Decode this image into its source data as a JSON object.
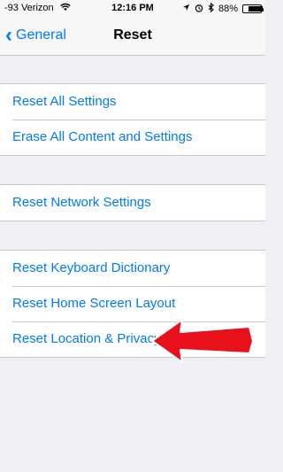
{
  "status_bar": {
    "carrier": "-93 Verizon",
    "time": "12:16 PM",
    "battery": "88%",
    "battery_level": 0.88
  },
  "nav": {
    "back_label": "General",
    "title": "Reset"
  },
  "groups": [
    {
      "rows": [
        {
          "label": "Reset All Settings"
        },
        {
          "label": "Erase All Content and Settings"
        }
      ]
    },
    {
      "rows": [
        {
          "label": "Reset Network Settings"
        }
      ]
    },
    {
      "rows": [
        {
          "label": "Reset Keyboard Dictionary"
        },
        {
          "label": "Reset Home Screen Layout"
        },
        {
          "label": "Reset Location & Privacy"
        }
      ]
    }
  ],
  "colors": {
    "accent": "#007aff",
    "annotation_arrow": "#e8101a",
    "background": "#efeff4"
  },
  "icons": [
    "wifi-icon",
    "location-arrow-icon",
    "alarm-icon",
    "bluetooth-icon",
    "battery-icon",
    "chevron-left-icon"
  ]
}
